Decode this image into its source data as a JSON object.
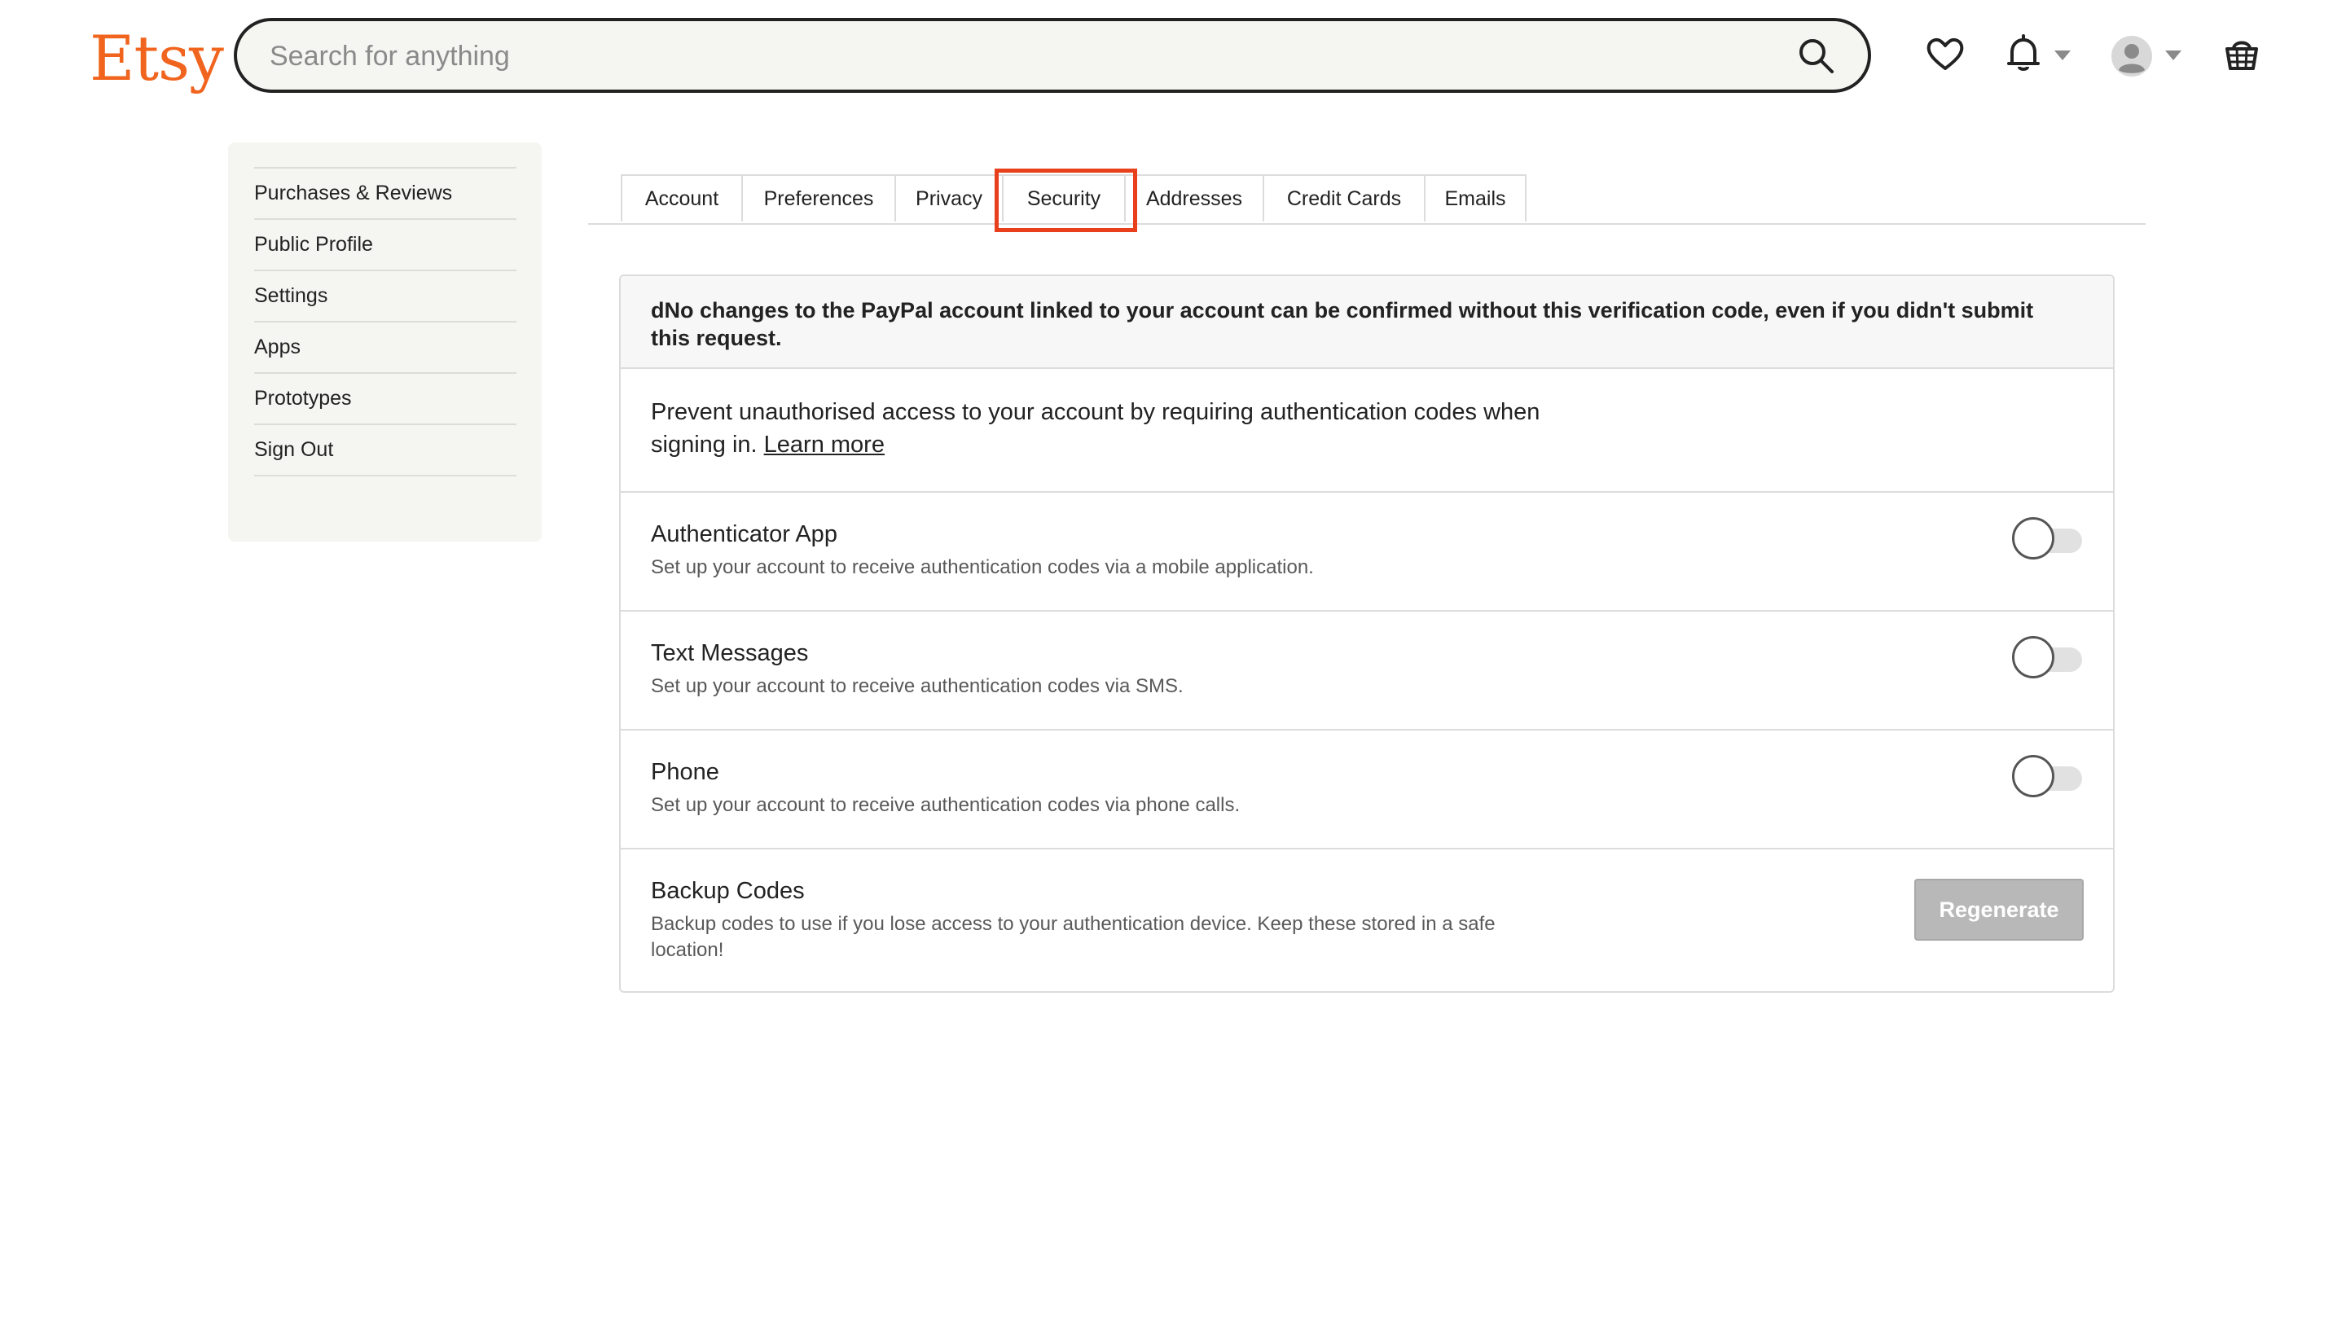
{
  "header": {
    "logo": "Etsy",
    "search_placeholder": "Search for anything"
  },
  "sidebar": {
    "items": [
      {
        "label": "Purchases & Reviews"
      },
      {
        "label": "Public Profile"
      },
      {
        "label": "Settings"
      },
      {
        "label": "Apps"
      },
      {
        "label": "Prototypes"
      },
      {
        "label": "Sign Out"
      }
    ]
  },
  "tabs": [
    {
      "label": "Account"
    },
    {
      "label": "Preferences"
    },
    {
      "label": "Privacy"
    },
    {
      "label": "Security",
      "active": true
    },
    {
      "label": "Addresses"
    },
    {
      "label": "Credit Cards"
    },
    {
      "label": "Emails"
    }
  ],
  "security": {
    "notice": "dNo changes to the PayPal account linked to your account can be confirmed without this verification code, even if you didn't submit this request.",
    "intro": "Prevent unauthorised access to your account by requiring authentication codes when signing in.",
    "learn_more": "Learn more",
    "methods": [
      {
        "title": "Authenticator App",
        "desc": "Set up your account to receive authentication codes via a mobile application.",
        "enabled": false
      },
      {
        "title": "Text Messages",
        "desc": "Set up your account to receive authentication codes via SMS.",
        "enabled": false
      },
      {
        "title": "Phone",
        "desc": "Set up your account to receive authentication codes via phone calls.",
        "enabled": false
      }
    ],
    "backup": {
      "title": "Backup Codes",
      "desc": "Backup codes to use if you lose access to your authentication device. Keep these stored in a safe location!",
      "button": "Regenerate"
    }
  },
  "colors": {
    "brand": "#F1641E",
    "highlight": "#E8401C",
    "button_disabled": "#B8B8B8"
  }
}
